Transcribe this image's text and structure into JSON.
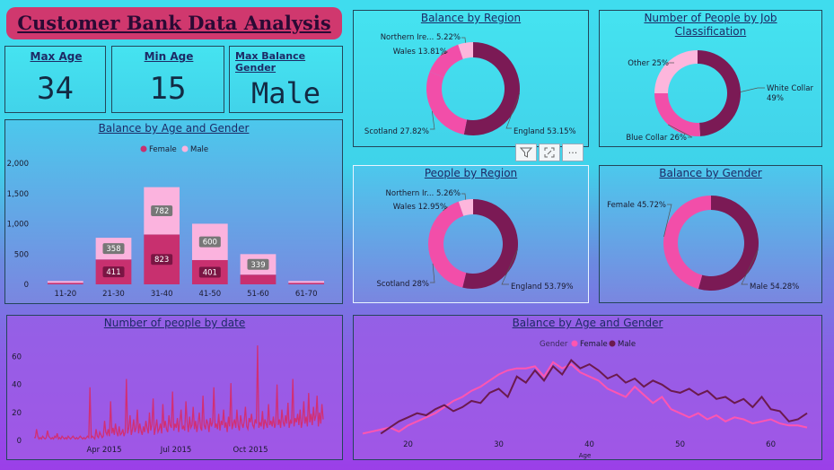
{
  "title": "Customer Bank Data Analysis",
  "kpis": {
    "max_age": {
      "label": "Max Age",
      "value": "34"
    },
    "min_age": {
      "label": "Min Age",
      "value": "15"
    },
    "max_balance_gender": {
      "label": "Max Balance Gender",
      "value": "Male"
    }
  },
  "toolbar": {
    "filter_icon": "filter-icon",
    "focus_icon": "focus-mode-icon",
    "more_icon": "more-options-icon",
    "more_label": "···"
  },
  "colors": {
    "dark": "#7b1a55",
    "pink": "#f24ea9",
    "light": "#fdb6dc",
    "female_bar": "#c8306f",
    "male_bar": "#fbb3de",
    "female_line": "#ff55b0",
    "male_line": "#6b1a4d"
  },
  "chart_data": [
    {
      "id": "balance_by_region",
      "type": "pie",
      "title": "Balance by Region",
      "slices": [
        {
          "label": "England",
          "value": 53.15,
          "text": "England 53.15%"
        },
        {
          "label": "Scotland",
          "value": 27.82,
          "text": "Scotland 27.82%"
        },
        {
          "label": "Wales",
          "value": 13.81,
          "text": "Wales 13.81%"
        },
        {
          "label": "Northern Ire...",
          "value": 5.22,
          "text": "Northern Ire... 5.22%"
        }
      ]
    },
    {
      "id": "people_by_job",
      "type": "pie",
      "title": "Number of People by Job Classification",
      "slices": [
        {
          "label": "White Collar",
          "value": 49,
          "text": "White Collar\n49%"
        },
        {
          "label": "Blue Collar",
          "value": 26,
          "text": "Blue Collar 26%"
        },
        {
          "label": "Other",
          "value": 25,
          "text": "Other 25%"
        }
      ]
    },
    {
      "id": "people_by_region",
      "type": "pie",
      "title": "People by Region",
      "slices": [
        {
          "label": "England",
          "value": 53.79,
          "text": "England 53.79%"
        },
        {
          "label": "Scotland",
          "value": 28,
          "text": "Scotland 28%"
        },
        {
          "label": "Wales",
          "value": 12.95,
          "text": "Wales 12.95%"
        },
        {
          "label": "Northern Ir...",
          "value": 5.26,
          "text": "Northern Ir... 5.26%"
        }
      ]
    },
    {
      "id": "balance_by_gender",
      "type": "pie",
      "title": "Balance by Gender",
      "slices": [
        {
          "label": "Male",
          "value": 54.28,
          "text": "Male 54.28%"
        },
        {
          "label": "Female",
          "value": 45.72,
          "text": "Female 45.72%"
        }
      ]
    },
    {
      "id": "balance_by_age_gender_bar",
      "type": "bar",
      "title": "Balance by Age and Gender",
      "categories": [
        "11-20",
        "21-30",
        "31-40",
        "41-50",
        "51-60",
        "61-70"
      ],
      "series": [
        {
          "name": "Female",
          "values": [
            25,
            411,
            823,
            401,
            160,
            25
          ],
          "labels": [
            "",
            "411",
            "823",
            "401",
            "",
            ""
          ]
        },
        {
          "name": "Male",
          "values": [
            30,
            358,
            782,
            600,
            339,
            30
          ],
          "labels": [
            "",
            "358",
            "782",
            "600",
            "339",
            ""
          ]
        }
      ],
      "yticks": [
        "0",
        "500",
        "1,000",
        "1,500",
        "2,000"
      ],
      "ylim": [
        0,
        2000
      ],
      "stacked": true,
      "legend": "top"
    },
    {
      "id": "people_by_date",
      "type": "line",
      "title": "Number of people by date",
      "xticks": [
        "Apr 2015",
        "Jul 2015",
        "Oct 2015"
      ],
      "yticks": [
        "0",
        "20",
        "40",
        "60"
      ],
      "ylim": [
        0,
        70
      ],
      "values": [
        2,
        2,
        8,
        3,
        1,
        2,
        1,
        3,
        2,
        1,
        2,
        7,
        3,
        2,
        1,
        2,
        1,
        3,
        2,
        5,
        1,
        2,
        1,
        3,
        2,
        1,
        2,
        1,
        3,
        2,
        1,
        2,
        3,
        2,
        1,
        2,
        1,
        2,
        3,
        2,
        1,
        2,
        1,
        2,
        3,
        2,
        38,
        2,
        3,
        2,
        1,
        8,
        3,
        2,
        6,
        4,
        2,
        3,
        14,
        6,
        4,
        8,
        3,
        28,
        5,
        9,
        4,
        12,
        6,
        3,
        10,
        4,
        5,
        8,
        3,
        6,
        44,
        5,
        9,
        18,
        4,
        8,
        15,
        6,
        9,
        22,
        5,
        12,
        7,
        4,
        10,
        6,
        14,
        9,
        5,
        20,
        7,
        11,
        30,
        4,
        9,
        15,
        6,
        8,
        12,
        5,
        26,
        9,
        14,
        8,
        6,
        18,
        11,
        9,
        35,
        7,
        12,
        9,
        16,
        6,
        14,
        22,
        8,
        10,
        7,
        28,
        13,
        6,
        17,
        9,
        11,
        24,
        8,
        14,
        6,
        12,
        20,
        9,
        7,
        32,
        11,
        8,
        15,
        12,
        6,
        16,
        10,
        13,
        38,
        9,
        12,
        8,
        19,
        7,
        14,
        11,
        22,
        9,
        13,
        6,
        17,
        10,
        41,
        8,
        12,
        15,
        9,
        22,
        11,
        7,
        18,
        12,
        9,
        14,
        24,
        10,
        8,
        16,
        13,
        19,
        11,
        9,
        15,
        12,
        68,
        9,
        13,
        10,
        21,
        8,
        15,
        12,
        9,
        26,
        11,
        14,
        10,
        17,
        9,
        12,
        40,
        11,
        15,
        9,
        22,
        13,
        10,
        18,
        12,
        27,
        9,
        14,
        12,
        44,
        10,
        16,
        13,
        19,
        11,
        22,
        9,
        14,
        28,
        12,
        17,
        10,
        34,
        13,
        19,
        11,
        24,
        14,
        18,
        32,
        10,
        20,
        12,
        26,
        15
      ]
    },
    {
      "id": "balance_by_age_gender_line",
      "type": "line",
      "title": "Balance by Age and Gender",
      "legend_title": "Gender",
      "xlabel": "Age",
      "xticks": [
        "20",
        "30",
        "40",
        "50",
        "60"
      ],
      "x": [
        15,
        16,
        17,
        18,
        19,
        20,
        21,
        22,
        23,
        24,
        25,
        26,
        27,
        28,
        29,
        30,
        31,
        32,
        33,
        34,
        35,
        36,
        37,
        38,
        39,
        40,
        41,
        42,
        43,
        44,
        45,
        46,
        47,
        48,
        49,
        50,
        51,
        52,
        53,
        54,
        55,
        56,
        57,
        58,
        59,
        60,
        61,
        62,
        63,
        64
      ],
      "series": [
        {
          "name": "Female",
          "values": [
            2,
            3,
            4,
            5,
            3,
            6,
            8,
            10,
            12,
            15,
            18,
            20,
            23,
            25,
            28,
            31,
            33,
            34,
            34,
            35,
            30,
            37,
            34,
            36,
            32,
            30,
            28,
            24,
            22,
            20,
            25,
            21,
            17,
            20,
            14,
            12,
            10,
            12,
            9,
            11,
            8,
            10,
            9,
            7,
            8,
            9,
            7,
            6,
            6,
            5
          ]
        },
        {
          "name": "Male",
          "values": [
            null,
            null,
            2,
            5,
            8,
            10,
            12,
            11,
            14,
            16,
            13,
            15,
            18,
            17,
            22,
            24,
            20,
            30,
            27,
            33,
            28,
            35,
            31,
            38,
            34,
            36,
            33,
            29,
            31,
            27,
            29,
            25,
            28,
            26,
            23,
            22,
            24,
            21,
            23,
            19,
            20,
            17,
            19,
            15,
            20,
            14,
            13,
            8,
            9,
            12
          ]
        }
      ],
      "legend": "top"
    }
  ]
}
